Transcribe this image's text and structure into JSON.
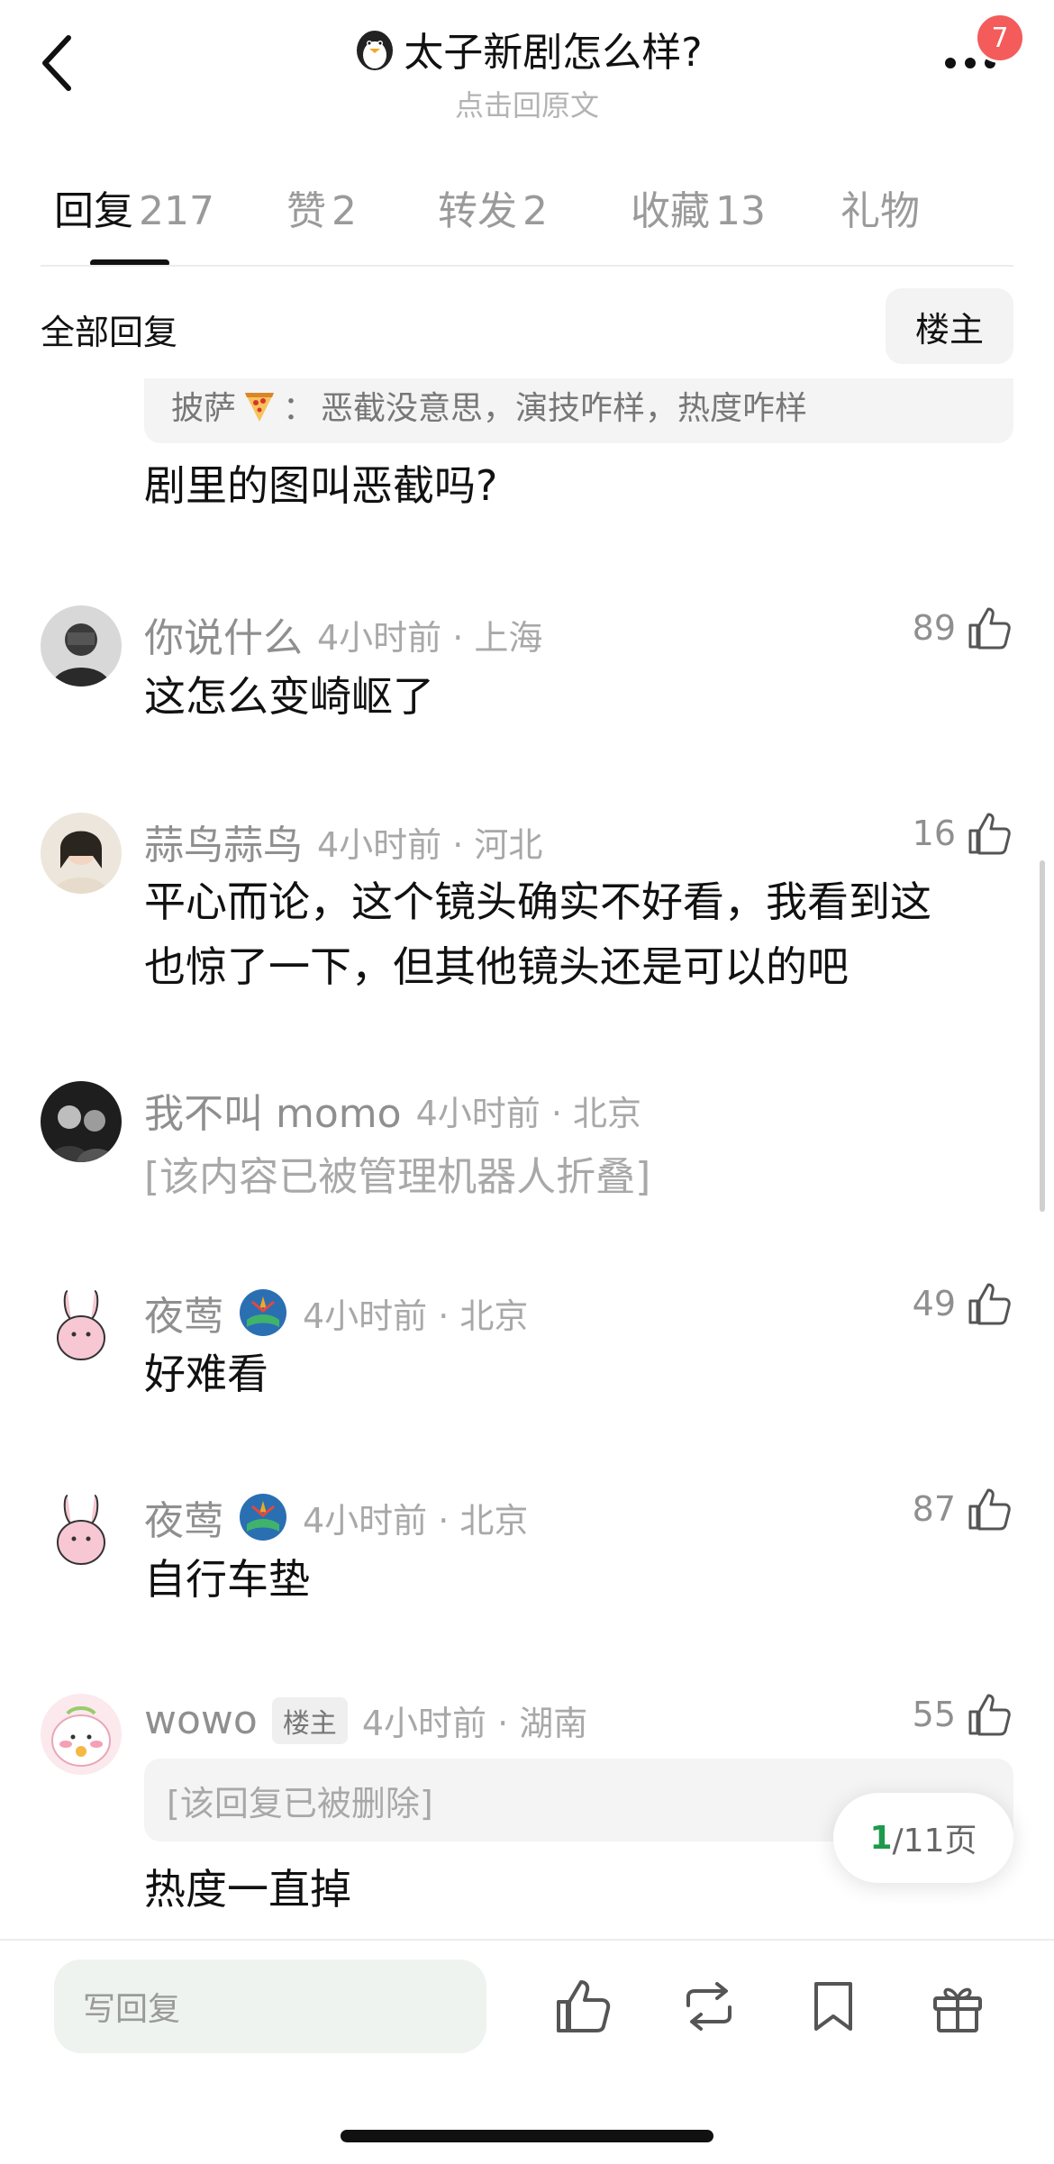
{
  "header": {
    "title": "太子新剧怎么样?",
    "subtitle": "点击回原文",
    "notification_count": "7"
  },
  "tabs": [
    {
      "label": "回复",
      "count": "217",
      "active": true
    },
    {
      "label": "赞",
      "count": "2"
    },
    {
      "label": "转发",
      "count": "2"
    },
    {
      "label": "收藏",
      "count": "13"
    },
    {
      "label": "礼物",
      "count": ""
    }
  ],
  "filter": {
    "label": "全部回复",
    "host_button": "楼主"
  },
  "partial_comment": {
    "quote_user": "披萨",
    "quote_colon": "：",
    "quote_text": "恶截没意思，演技咋样，热度咋样",
    "text": "剧里的图叫恶截吗?"
  },
  "comments": [
    {
      "name": "你说什么",
      "time": "4小时前 · 上海",
      "likes": "89",
      "text": "这怎么变崎岖了"
    },
    {
      "name": "蒜鸟蒜鸟",
      "time": "4小时前 · 河北",
      "likes": "16",
      "text_line1": "平心而论，这个镜头确实不好看，我看到这",
      "text_line2": "也惊了一下，但其他镜头还是可以的吧"
    },
    {
      "name": "我不叫 momo",
      "time": "4小时前 · 北京",
      "folded": "[该内容已被管理机器人折叠]"
    },
    {
      "name": "夜莺",
      "time": "4小时前 · 北京",
      "likes": "49",
      "text": "好难看"
    },
    {
      "name": "夜莺",
      "time": "4小时前 · 北京",
      "likes": "87",
      "text": "自行车垫"
    },
    {
      "name": "wowo",
      "tag": "楼主",
      "time": "4小时前 · 湖南",
      "likes": "55",
      "deleted": "[该回复已被删除]",
      "text": "热度一直掉"
    }
  ],
  "pager": {
    "current": "1",
    "total": "/11页"
  },
  "bottom": {
    "reply_placeholder": "写回复"
  },
  "colors": {
    "accent_green": "#1f9a4c",
    "badge_red": "#f45b5b"
  }
}
